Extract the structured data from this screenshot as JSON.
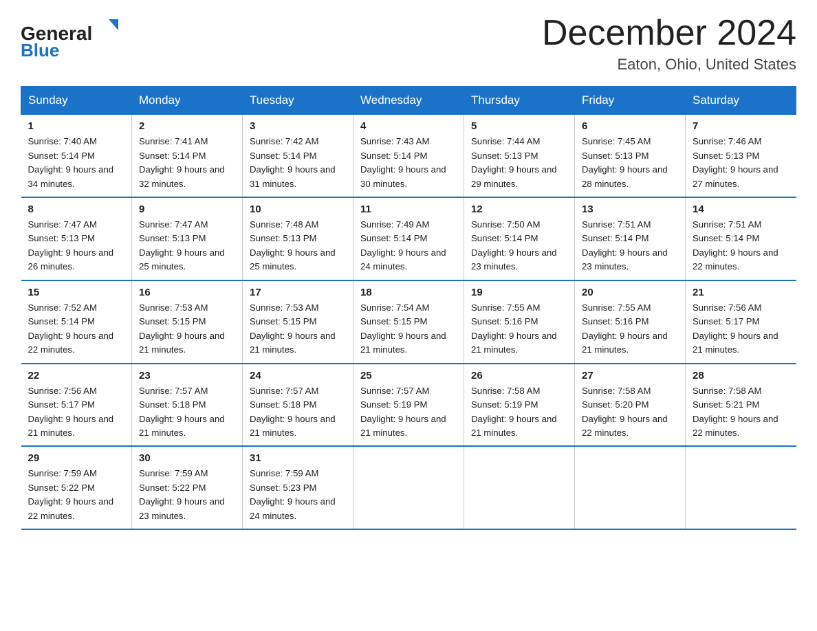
{
  "logo": {
    "text_general": "General",
    "text_blue": "Blue",
    "triangle_color": "#1a73c8"
  },
  "title": "December 2024",
  "subtitle": "Eaton, Ohio, United States",
  "days_of_week": [
    "Sunday",
    "Monday",
    "Tuesday",
    "Wednesday",
    "Thursday",
    "Friday",
    "Saturday"
  ],
  "weeks": [
    [
      {
        "day": "1",
        "sunrise": "Sunrise: 7:40 AM",
        "sunset": "Sunset: 5:14 PM",
        "daylight": "Daylight: 9 hours and 34 minutes."
      },
      {
        "day": "2",
        "sunrise": "Sunrise: 7:41 AM",
        "sunset": "Sunset: 5:14 PM",
        "daylight": "Daylight: 9 hours and 32 minutes."
      },
      {
        "day": "3",
        "sunrise": "Sunrise: 7:42 AM",
        "sunset": "Sunset: 5:14 PM",
        "daylight": "Daylight: 9 hours and 31 minutes."
      },
      {
        "day": "4",
        "sunrise": "Sunrise: 7:43 AM",
        "sunset": "Sunset: 5:14 PM",
        "daylight": "Daylight: 9 hours and 30 minutes."
      },
      {
        "day": "5",
        "sunrise": "Sunrise: 7:44 AM",
        "sunset": "Sunset: 5:13 PM",
        "daylight": "Daylight: 9 hours and 29 minutes."
      },
      {
        "day": "6",
        "sunrise": "Sunrise: 7:45 AM",
        "sunset": "Sunset: 5:13 PM",
        "daylight": "Daylight: 9 hours and 28 minutes."
      },
      {
        "day": "7",
        "sunrise": "Sunrise: 7:46 AM",
        "sunset": "Sunset: 5:13 PM",
        "daylight": "Daylight: 9 hours and 27 minutes."
      }
    ],
    [
      {
        "day": "8",
        "sunrise": "Sunrise: 7:47 AM",
        "sunset": "Sunset: 5:13 PM",
        "daylight": "Daylight: 9 hours and 26 minutes."
      },
      {
        "day": "9",
        "sunrise": "Sunrise: 7:47 AM",
        "sunset": "Sunset: 5:13 PM",
        "daylight": "Daylight: 9 hours and 25 minutes."
      },
      {
        "day": "10",
        "sunrise": "Sunrise: 7:48 AM",
        "sunset": "Sunset: 5:13 PM",
        "daylight": "Daylight: 9 hours and 25 minutes."
      },
      {
        "day": "11",
        "sunrise": "Sunrise: 7:49 AM",
        "sunset": "Sunset: 5:14 PM",
        "daylight": "Daylight: 9 hours and 24 minutes."
      },
      {
        "day": "12",
        "sunrise": "Sunrise: 7:50 AM",
        "sunset": "Sunset: 5:14 PM",
        "daylight": "Daylight: 9 hours and 23 minutes."
      },
      {
        "day": "13",
        "sunrise": "Sunrise: 7:51 AM",
        "sunset": "Sunset: 5:14 PM",
        "daylight": "Daylight: 9 hours and 23 minutes."
      },
      {
        "day": "14",
        "sunrise": "Sunrise: 7:51 AM",
        "sunset": "Sunset: 5:14 PM",
        "daylight": "Daylight: 9 hours and 22 minutes."
      }
    ],
    [
      {
        "day": "15",
        "sunrise": "Sunrise: 7:52 AM",
        "sunset": "Sunset: 5:14 PM",
        "daylight": "Daylight: 9 hours and 22 minutes."
      },
      {
        "day": "16",
        "sunrise": "Sunrise: 7:53 AM",
        "sunset": "Sunset: 5:15 PM",
        "daylight": "Daylight: 9 hours and 21 minutes."
      },
      {
        "day": "17",
        "sunrise": "Sunrise: 7:53 AM",
        "sunset": "Sunset: 5:15 PM",
        "daylight": "Daylight: 9 hours and 21 minutes."
      },
      {
        "day": "18",
        "sunrise": "Sunrise: 7:54 AM",
        "sunset": "Sunset: 5:15 PM",
        "daylight": "Daylight: 9 hours and 21 minutes."
      },
      {
        "day": "19",
        "sunrise": "Sunrise: 7:55 AM",
        "sunset": "Sunset: 5:16 PM",
        "daylight": "Daylight: 9 hours and 21 minutes."
      },
      {
        "day": "20",
        "sunrise": "Sunrise: 7:55 AM",
        "sunset": "Sunset: 5:16 PM",
        "daylight": "Daylight: 9 hours and 21 minutes."
      },
      {
        "day": "21",
        "sunrise": "Sunrise: 7:56 AM",
        "sunset": "Sunset: 5:17 PM",
        "daylight": "Daylight: 9 hours and 21 minutes."
      }
    ],
    [
      {
        "day": "22",
        "sunrise": "Sunrise: 7:56 AM",
        "sunset": "Sunset: 5:17 PM",
        "daylight": "Daylight: 9 hours and 21 minutes."
      },
      {
        "day": "23",
        "sunrise": "Sunrise: 7:57 AM",
        "sunset": "Sunset: 5:18 PM",
        "daylight": "Daylight: 9 hours and 21 minutes."
      },
      {
        "day": "24",
        "sunrise": "Sunrise: 7:57 AM",
        "sunset": "Sunset: 5:18 PM",
        "daylight": "Daylight: 9 hours and 21 minutes."
      },
      {
        "day": "25",
        "sunrise": "Sunrise: 7:57 AM",
        "sunset": "Sunset: 5:19 PM",
        "daylight": "Daylight: 9 hours and 21 minutes."
      },
      {
        "day": "26",
        "sunrise": "Sunrise: 7:58 AM",
        "sunset": "Sunset: 5:19 PM",
        "daylight": "Daylight: 9 hours and 21 minutes."
      },
      {
        "day": "27",
        "sunrise": "Sunrise: 7:58 AM",
        "sunset": "Sunset: 5:20 PM",
        "daylight": "Daylight: 9 hours and 22 minutes."
      },
      {
        "day": "28",
        "sunrise": "Sunrise: 7:58 AM",
        "sunset": "Sunset: 5:21 PM",
        "daylight": "Daylight: 9 hours and 22 minutes."
      }
    ],
    [
      {
        "day": "29",
        "sunrise": "Sunrise: 7:59 AM",
        "sunset": "Sunset: 5:22 PM",
        "daylight": "Daylight: 9 hours and 22 minutes."
      },
      {
        "day": "30",
        "sunrise": "Sunrise: 7:59 AM",
        "sunset": "Sunset: 5:22 PM",
        "daylight": "Daylight: 9 hours and 23 minutes."
      },
      {
        "day": "31",
        "sunrise": "Sunrise: 7:59 AM",
        "sunset": "Sunset: 5:23 PM",
        "daylight": "Daylight: 9 hours and 24 minutes."
      },
      null,
      null,
      null,
      null
    ]
  ]
}
